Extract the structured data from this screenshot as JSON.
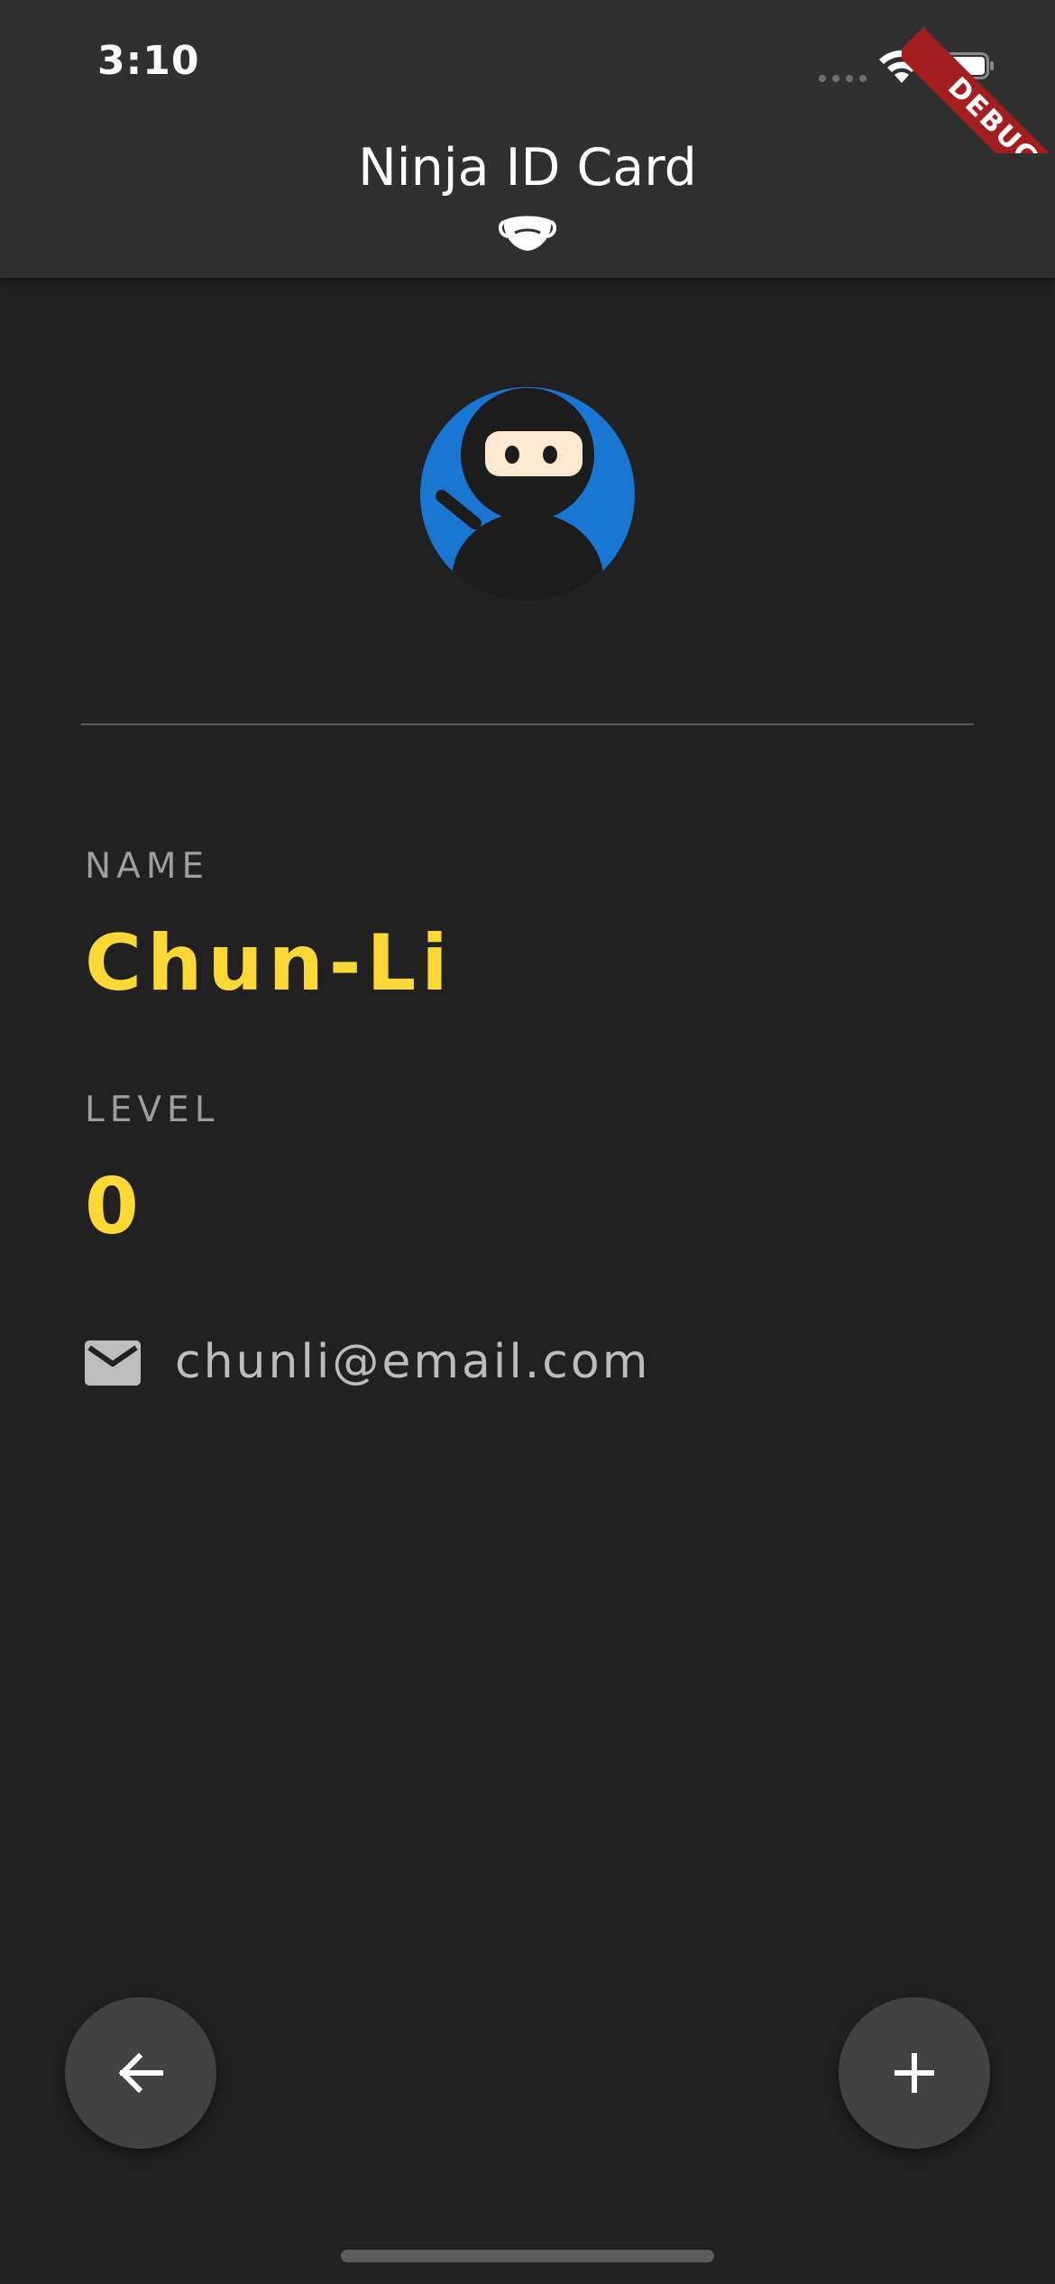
{
  "status_bar": {
    "time": "3:10"
  },
  "debug_banner": {
    "text": "DEBUG",
    "color": "#a31f1f"
  },
  "app_bar": {
    "title": "Ninja ID Card",
    "icon": "mask-icon"
  },
  "profile": {
    "avatar_icon": "ninja-avatar",
    "name_label": "NAME",
    "name_value": "Chun-Li",
    "level_label": "LEVEL",
    "level_value": "0",
    "email_icon": "mail-icon",
    "email": "chunli@email.com"
  },
  "actions": {
    "back_icon": "arrow-back-icon",
    "add_icon": "plus-icon"
  },
  "colors": {
    "background": "#212121",
    "app_bar": "#303030",
    "accent": "#fdd835",
    "label": "#9e9e9e",
    "avatar_bg": "#1976d2",
    "fab": "#424242"
  }
}
